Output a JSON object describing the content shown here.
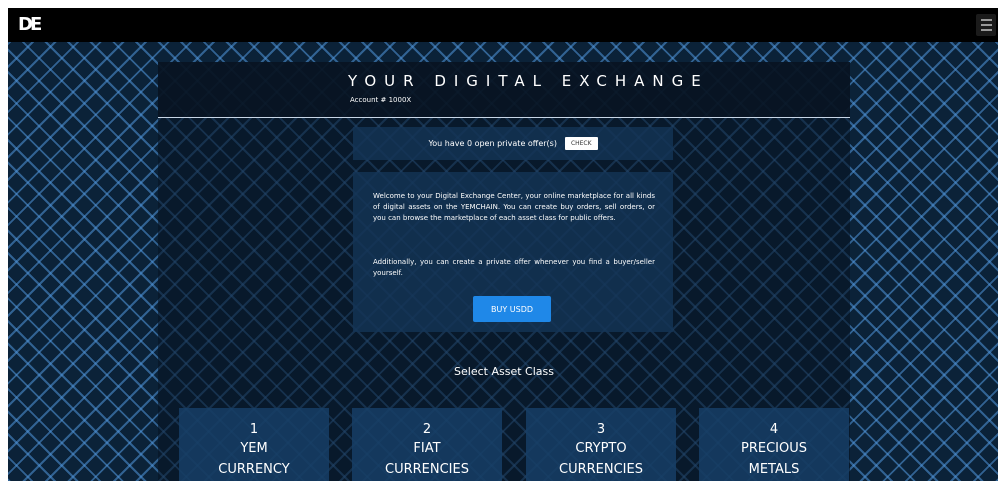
{
  "topbar": {
    "logo_text": "DE",
    "menu_icon": "hamburger-menu-icon"
  },
  "header": {
    "title": "YOUR DIGITAL EXCHANGE",
    "account": "Account # 1000X"
  },
  "offers": {
    "text": "You have 0 open private offer(s)",
    "check_label": "CHECK"
  },
  "welcome": {
    "paragraph1": "Welcome to your Digital Exchange Center, your online marketplace for all kinds of digital assets on the YEMCHAIN. You can create buy orders, sell orders, or you can browse the marketplace of each asset class for public offers.",
    "paragraph2": "Additionally, you can create a private offer whenever you find a buyer/seller yourself.",
    "buy_label": "BUY USDD"
  },
  "asset_section": {
    "title": "Select Asset Class",
    "cards": [
      {
        "number": "1",
        "line1": "YEM",
        "line2": "CURRENCY"
      },
      {
        "number": "2",
        "line1": "FIAT",
        "line2": "CURRENCIES"
      },
      {
        "number": "3",
        "line1": "CRYPTO",
        "line2": "CURRENCIES"
      },
      {
        "number": "4",
        "line1": "PRECIOUS",
        "line2": "METALS"
      }
    ]
  },
  "colors": {
    "topbar": "#000000",
    "background": "#0b2238",
    "pattern": "#5096dc",
    "panel": "#061424",
    "box": "#143456",
    "accent_button": "#1f88e8"
  }
}
